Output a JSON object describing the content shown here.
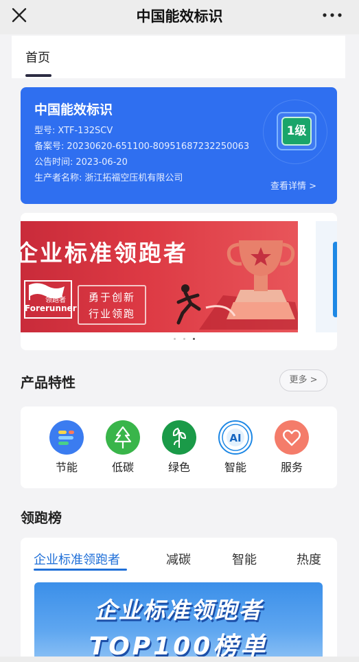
{
  "topbar": {
    "title": "中国能效标识",
    "close_icon": "close-icon",
    "more_icon": "more-dots-icon"
  },
  "tabs": {
    "home_label": "首页"
  },
  "energy_label": {
    "title": "中国能效标识",
    "model_label": "型号:",
    "model_value": "XTF-132SCV",
    "record_label": "备案号:",
    "record_value": "20230620-651100-80951687232250063",
    "date_label": "公告时间:",
    "date_value": "2023-06-20",
    "maker_label": "生产者名称:",
    "maker_value": "浙江拓福空压机有限公司",
    "level": "1级",
    "detail_link": "查看详情 >",
    "accent_color": "#2f6ff0",
    "level_color": "#1aa56a"
  },
  "banner": {
    "headline": "企业标准领跑者",
    "slogan_line1": "勇于创新",
    "slogan_line2": "行业领跑",
    "badge_cn": "领跑者",
    "badge_en": "Forerunner",
    "carousel_count": 3,
    "carousel_active": 3
  },
  "features": {
    "title": "产品特性",
    "more_label": "更多 >",
    "items": [
      {
        "label": "节能",
        "icon": "energy-saving-icon",
        "color": "#3b7cf0"
      },
      {
        "label": "低碳",
        "icon": "low-carbon-tree-icon",
        "color": "#39b54a"
      },
      {
        "label": "绿色",
        "icon": "green-leaf-icon",
        "color": "#1a9a48"
      },
      {
        "label": "智能",
        "icon": "ai-badge-icon",
        "color": "#1e88e5"
      },
      {
        "label": "服务",
        "icon": "heart-service-icon",
        "color": "#f47c6a"
      }
    ]
  },
  "ranking": {
    "title": "领跑榜",
    "tabs": [
      "企业标准领跑者",
      "减碳",
      "智能",
      "热度"
    ],
    "active_tab": 0,
    "banner_line1": "企业标准领跑者",
    "banner_line2": "TOP100榜单"
  }
}
